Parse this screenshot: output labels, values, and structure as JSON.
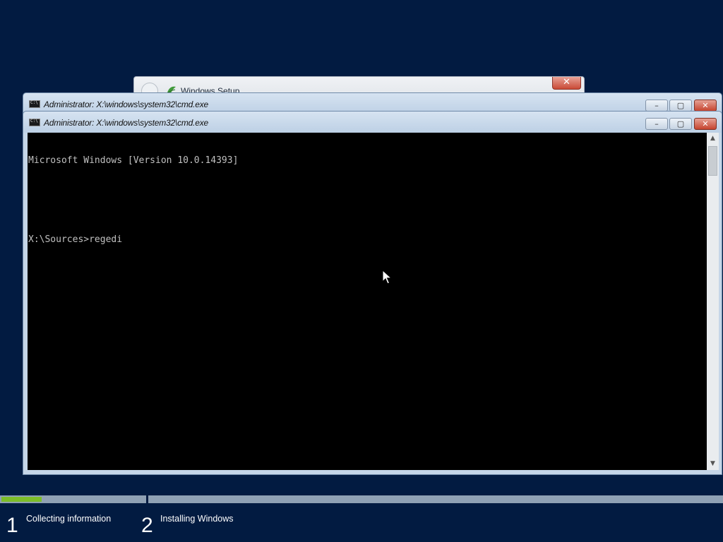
{
  "setup_window": {
    "title": "Windows Setup",
    "close_label": "✕"
  },
  "cmd_back": {
    "title": "Administrator: X:\\windows\\system32\\cmd.exe",
    "min_label": "–",
    "max_label": "▢",
    "close_label": "✕"
  },
  "cmd_front": {
    "title": "Administrator: X:\\windows\\system32\\cmd.exe",
    "min_label": "–",
    "max_label": "▢",
    "close_label": "✕",
    "console": {
      "line1": "Microsoft Windows [Version 10.0.14393]",
      "line2": "X:\\Sources>regedi"
    },
    "scroll_up": "▲",
    "scroll_down": "▼"
  },
  "progress": {
    "step1_fraction": 0.28
  },
  "steps": [
    {
      "number": "1",
      "label": "Collecting information"
    },
    {
      "number": "2",
      "label": "Installing Windows"
    }
  ],
  "colors": {
    "background": "#021b41",
    "progress_fill": "#7cbd28",
    "console_bg": "#000000",
    "console_text": "#c0c0c0"
  }
}
